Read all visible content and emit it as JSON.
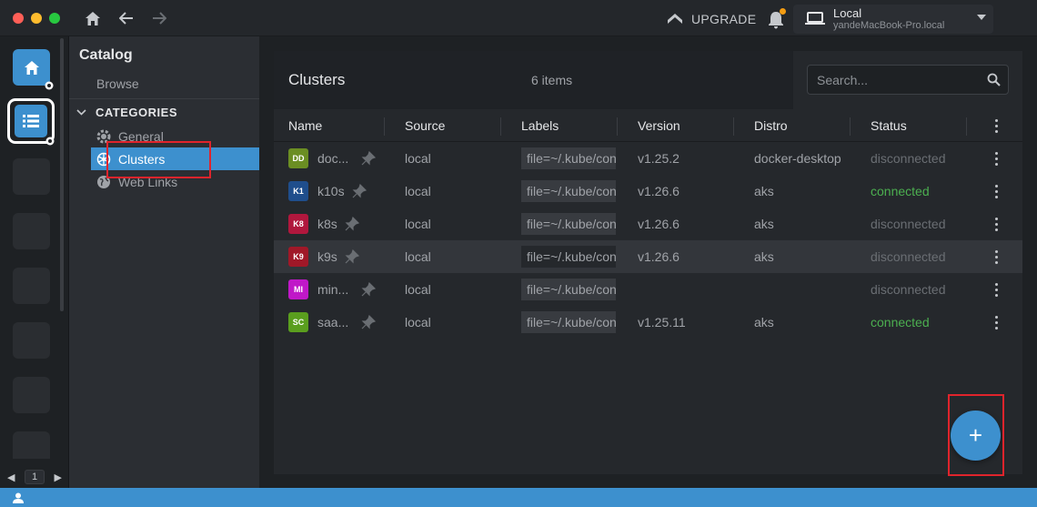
{
  "titlebar": {
    "upgrade_label": "UPGRADE",
    "context": {
      "name": "Local",
      "host": "yandeMacBook-Pro.local"
    }
  },
  "hotbar": {
    "page": "1"
  },
  "sidebar": {
    "title": "Catalog",
    "browse": "Browse",
    "categories_label": "CATEGORIES",
    "items": [
      {
        "label": "General",
        "icon": "gear-icon"
      },
      {
        "label": "Clusters",
        "icon": "kubernetes-icon"
      },
      {
        "label": "Web Links",
        "icon": "globe-icon"
      }
    ]
  },
  "panel": {
    "title": "Clusters",
    "count": "6 items",
    "search_placeholder": "Search..."
  },
  "table": {
    "columns": [
      "Name",
      "Source",
      "Labels",
      "Version",
      "Distro",
      "Status"
    ],
    "rows": [
      {
        "initials": "DD",
        "color": "#6b8e23",
        "name": "doc...",
        "source": "local",
        "labels": "file=~/.kube/config",
        "version": "v1.25.2",
        "distro": "docker-desktop",
        "status": "disconnected"
      },
      {
        "initials": "K1",
        "color": "#1f4e8c",
        "name": "k10s",
        "source": "local",
        "labels": "file=~/.kube/config",
        "version": "v1.26.6",
        "distro": "aks",
        "status": "connected"
      },
      {
        "initials": "K8",
        "color": "#b0173d",
        "name": "k8s",
        "source": "local",
        "labels": "file=~/.kube/config",
        "version": "v1.26.6",
        "distro": "aks",
        "status": "disconnected"
      },
      {
        "initials": "K9",
        "color": "#a01828",
        "name": "k9s",
        "source": "local",
        "labels": "file=~/.kube/config",
        "version": "v1.26.6",
        "distro": "aks",
        "status": "disconnected"
      },
      {
        "initials": "MI",
        "color": "#c018c8",
        "name": "min...",
        "source": "local",
        "labels": "file=~/.kube/config",
        "version": "",
        "distro": "",
        "status": "disconnected"
      },
      {
        "initials": "SC",
        "color": "#5a9e1e",
        "name": "saa...",
        "source": "local",
        "labels": "file=~/.kube/config",
        "version": "v1.25.11",
        "distro": "aks",
        "status": "connected"
      }
    ]
  },
  "fab_label": "+",
  "colors": {
    "accent": "#3d90ce",
    "connected": "#4caf50",
    "disconnected": "#6a6e73",
    "highlight_box": "#e0242c"
  }
}
